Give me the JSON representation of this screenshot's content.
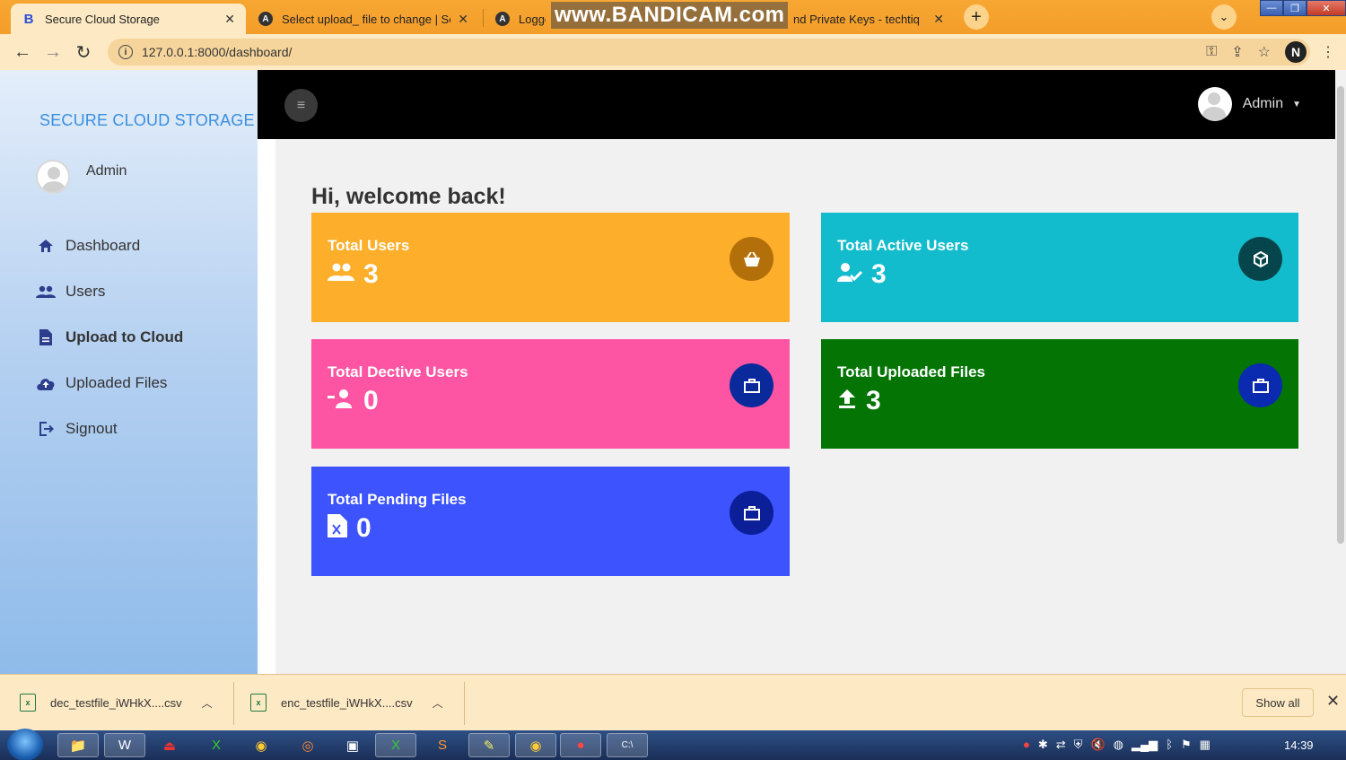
{
  "browser": {
    "tabs": [
      {
        "title": "Secure Cloud Storage",
        "favicon": "B"
      },
      {
        "title": "Select upload_ file to change | Se",
        "favicon": "A"
      },
      {
        "title": "Logge",
        "favicon": "A"
      },
      {
        "title": "nd Private Keys - techtiq",
        "favicon": ""
      }
    ],
    "watermark": "www.BANDICAM.com",
    "url": "127.0.0.1:8000/dashboard/"
  },
  "sidebar": {
    "brand": "SECURE CLOUD STORAGE",
    "user": "Admin",
    "items": [
      {
        "label": "Dashboard",
        "icon": "home-icon"
      },
      {
        "label": "Users",
        "icon": "users-icon"
      },
      {
        "label": "Upload to Cloud",
        "icon": "file-icon"
      },
      {
        "label": "Uploaded Files",
        "icon": "cloud-upload-icon"
      },
      {
        "label": "Signout",
        "icon": "signout-icon"
      }
    ]
  },
  "topbar": {
    "user": "Admin"
  },
  "main": {
    "welcome": "Hi, welcome back!",
    "cards": [
      {
        "title": "Total Users",
        "value": "3",
        "color": "#fdaf2b"
      },
      {
        "title": "Total Active Users",
        "value": "3",
        "color": "#12bccc"
      },
      {
        "title": "Total Dective Users",
        "value": "0",
        "color": "#fd55a3"
      },
      {
        "title": "Total Uploaded Files",
        "value": "3",
        "color": "#047504"
      },
      {
        "title": "Total Pending Files",
        "value": "0",
        "color": "#3c53fd"
      }
    ]
  },
  "downloads": {
    "items": [
      {
        "name": "dec_testfile_iWHkX....csv"
      },
      {
        "name": "enc_testfile_iWHkX....csv"
      }
    ],
    "show_all": "Show all"
  },
  "taskbar": {
    "clock": "14:39"
  }
}
